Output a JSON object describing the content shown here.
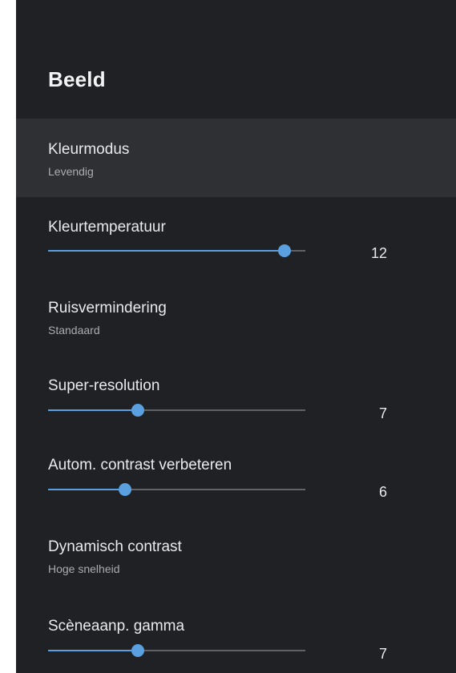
{
  "header": {
    "title": "Beeld"
  },
  "settings": {
    "color_mode": {
      "label": "Kleurmodus",
      "value": "Levendig"
    },
    "color_temperature": {
      "label": "Kleurtemperatuur",
      "value": "12",
      "level_fraction": 0.92
    },
    "noise_reduction": {
      "label": "Ruisvermindering",
      "value": "Standaard"
    },
    "super_resolution": {
      "label": "Super-resolution",
      "value": "7",
      "level_fraction": 0.35
    },
    "auto_contrast": {
      "label": "Autom. contrast verbeteren",
      "value": "6",
      "level_fraction": 0.3
    },
    "dynamic_contrast": {
      "label": "Dynamisch contrast",
      "value": "Hoge snelheid"
    },
    "scene_gamma": {
      "label": "Scèneaanp. gamma",
      "value": "7",
      "level_fraction": 0.35
    }
  },
  "colors": {
    "background": "#202124",
    "focused_row": "#2e3033",
    "accent": "#5aa0e0",
    "track": "#5f6368"
  }
}
